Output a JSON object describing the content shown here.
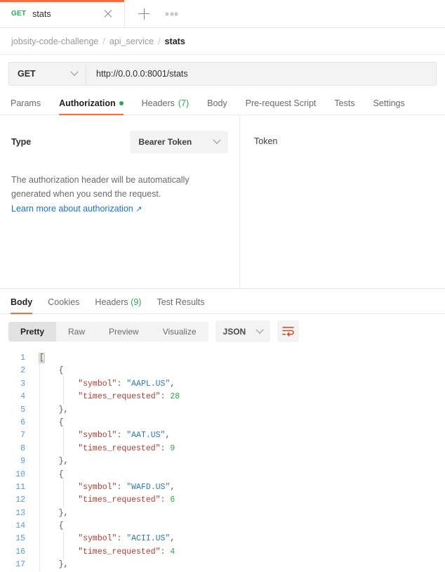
{
  "tab": {
    "method": "GET",
    "title": "stats",
    "close_icon": "close-icon",
    "new_tab_icon": "plus-icon",
    "more_icon": "ellipsis-icon"
  },
  "breadcrumb": {
    "items": [
      "jobsity-code-challenge",
      "api_service",
      "stats"
    ],
    "separator": "/"
  },
  "request": {
    "method": "GET",
    "url": "http://0.0.0.0:8001/stats",
    "tabs": [
      {
        "label": "Params",
        "active": false,
        "badge": ""
      },
      {
        "label": "Authorization",
        "active": true,
        "badge": "dot"
      },
      {
        "label": "Headers",
        "active": false,
        "badge": "(7)"
      },
      {
        "label": "Body",
        "active": false,
        "badge": ""
      },
      {
        "label": "Pre-request Script",
        "active": false,
        "badge": ""
      },
      {
        "label": "Tests",
        "active": false,
        "badge": ""
      },
      {
        "label": "Settings",
        "active": false,
        "badge": ""
      }
    ]
  },
  "authorization": {
    "type_label": "Type",
    "type_value": "Bearer Token",
    "description_line1": "The authorization header will be automatically",
    "description_line2": "generated when you send the request.",
    "learn_more": "Learn more about authorization",
    "external_link_glyph": "↗",
    "token_label": "Token"
  },
  "response": {
    "tabs": [
      {
        "label": "Body",
        "active": true,
        "badge": ""
      },
      {
        "label": "Cookies",
        "active": false,
        "badge": ""
      },
      {
        "label": "Headers",
        "active": false,
        "badge": "(9)"
      },
      {
        "label": "Test Results",
        "active": false,
        "badge": ""
      }
    ],
    "views": [
      {
        "label": "Pretty",
        "active": true
      },
      {
        "label": "Raw",
        "active": false
      },
      {
        "label": "Preview",
        "active": false
      },
      {
        "label": "Visualize",
        "active": false
      }
    ],
    "format": "JSON",
    "wrap_icon": "wrap-text-icon"
  },
  "body_json": {
    "lines": [
      {
        "n": 1,
        "indent": 0,
        "tokens": [
          {
            "t": "[",
            "c": "pun-hl"
          }
        ]
      },
      {
        "n": 2,
        "indent": 1,
        "tokens": [
          {
            "t": "{",
            "c": "pun"
          }
        ]
      },
      {
        "n": 3,
        "indent": 2,
        "tokens": [
          {
            "t": "\"symbol\"",
            "c": "key"
          },
          {
            "t": ": ",
            "c": "pun"
          },
          {
            "t": "\"AAPL.US\"",
            "c": "str"
          },
          {
            "t": ",",
            "c": "pun"
          }
        ]
      },
      {
        "n": 4,
        "indent": 2,
        "tokens": [
          {
            "t": "\"times_requested\"",
            "c": "key"
          },
          {
            "t": ": ",
            "c": "pun"
          },
          {
            "t": "28",
            "c": "num"
          }
        ]
      },
      {
        "n": 5,
        "indent": 1,
        "tokens": [
          {
            "t": "},",
            "c": "pun"
          }
        ]
      },
      {
        "n": 6,
        "indent": 1,
        "tokens": [
          {
            "t": "{",
            "c": "pun"
          }
        ]
      },
      {
        "n": 7,
        "indent": 2,
        "tokens": [
          {
            "t": "\"symbol\"",
            "c": "key"
          },
          {
            "t": ": ",
            "c": "pun"
          },
          {
            "t": "\"AAT.US\"",
            "c": "str"
          },
          {
            "t": ",",
            "c": "pun"
          }
        ]
      },
      {
        "n": 8,
        "indent": 2,
        "tokens": [
          {
            "t": "\"times_requested\"",
            "c": "key"
          },
          {
            "t": ": ",
            "c": "pun"
          },
          {
            "t": "9",
            "c": "num"
          }
        ]
      },
      {
        "n": 9,
        "indent": 1,
        "tokens": [
          {
            "t": "},",
            "c": "pun"
          }
        ]
      },
      {
        "n": 10,
        "indent": 1,
        "tokens": [
          {
            "t": "{",
            "c": "pun"
          }
        ]
      },
      {
        "n": 11,
        "indent": 2,
        "tokens": [
          {
            "t": "\"symbol\"",
            "c": "key"
          },
          {
            "t": ": ",
            "c": "pun"
          },
          {
            "t": "\"WAFD.US\"",
            "c": "str"
          },
          {
            "t": ",",
            "c": "pun"
          }
        ]
      },
      {
        "n": 12,
        "indent": 2,
        "tokens": [
          {
            "t": "\"times_requested\"",
            "c": "key"
          },
          {
            "t": ": ",
            "c": "pun"
          },
          {
            "t": "6",
            "c": "num"
          }
        ]
      },
      {
        "n": 13,
        "indent": 1,
        "tokens": [
          {
            "t": "},",
            "c": "pun"
          }
        ]
      },
      {
        "n": 14,
        "indent": 1,
        "tokens": [
          {
            "t": "{",
            "c": "pun"
          }
        ]
      },
      {
        "n": 15,
        "indent": 2,
        "tokens": [
          {
            "t": "\"symbol\"",
            "c": "key"
          },
          {
            "t": ": ",
            "c": "pun"
          },
          {
            "t": "\"ACII.US\"",
            "c": "str"
          },
          {
            "t": ",",
            "c": "pun"
          }
        ]
      },
      {
        "n": 16,
        "indent": 2,
        "tokens": [
          {
            "t": "\"times_requested\"",
            "c": "key"
          },
          {
            "t": ": ",
            "c": "pun"
          },
          {
            "t": "4",
            "c": "num"
          }
        ]
      },
      {
        "n": 17,
        "indent": 1,
        "tokens": [
          {
            "t": "},",
            "c": "pun"
          }
        ]
      }
    ],
    "records": [
      {
        "symbol": "AAPL.US",
        "times_requested": 28
      },
      {
        "symbol": "AAT.US",
        "times_requested": 9
      },
      {
        "symbol": "WAFD.US",
        "times_requested": 6
      },
      {
        "symbol": "ACII.US",
        "times_requested": 4
      }
    ]
  },
  "colors": {
    "accent": "#ff6c37",
    "method_green": "#2aaa55",
    "link_blue": "#1a73c7",
    "json_key": "#b03a2e",
    "json_string": "#2a7ab0",
    "json_number": "#2aaa55",
    "line_number": "#5b9ad4"
  }
}
